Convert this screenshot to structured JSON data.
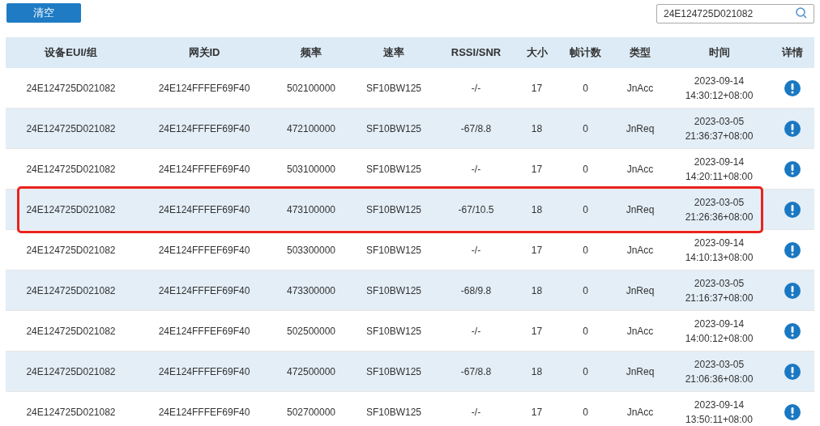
{
  "toolbar": {
    "clear_button": "清空",
    "search": {
      "value": "24E124725D021082"
    }
  },
  "table": {
    "columns": [
      "设备EUI/组",
      "网关ID",
      "频率",
      "速率",
      "RSSI/SNR",
      "大小",
      "帧计数",
      "类型",
      "时间",
      "详情"
    ],
    "rows": [
      {
        "eui": "24E124725D021082",
        "gateway": "24E124FFFEF69F40",
        "freq": "502100000",
        "rate": "SF10BW125",
        "rssi_snr": "-/-",
        "size": "17",
        "fcnt": "0",
        "type": "JnAcc",
        "date": "2023-09-14",
        "time": "14:30:12+08:00",
        "highlighted": false
      },
      {
        "eui": "24E124725D021082",
        "gateway": "24E124FFFEF69F40",
        "freq": "472100000",
        "rate": "SF10BW125",
        "rssi_snr": "-67/8.8",
        "size": "18",
        "fcnt": "0",
        "type": "JnReq",
        "date": "2023-03-05",
        "time": "21:36:37+08:00",
        "highlighted": false
      },
      {
        "eui": "24E124725D021082",
        "gateway": "24E124FFFEF69F40",
        "freq": "503100000",
        "rate": "SF10BW125",
        "rssi_snr": "-/-",
        "size": "17",
        "fcnt": "0",
        "type": "JnAcc",
        "date": "2023-09-14",
        "time": "14:20:11+08:00",
        "highlighted": false
      },
      {
        "eui": "24E124725D021082",
        "gateway": "24E124FFFEF69F40",
        "freq": "473100000",
        "rate": "SF10BW125",
        "rssi_snr": "-67/10.5",
        "size": "18",
        "fcnt": "0",
        "type": "JnReq",
        "date": "2023-03-05",
        "time": "21:26:36+08:00",
        "highlighted": true
      },
      {
        "eui": "24E124725D021082",
        "gateway": "24E124FFFEF69F40",
        "freq": "503300000",
        "rate": "SF10BW125",
        "rssi_snr": "-/-",
        "size": "17",
        "fcnt": "0",
        "type": "JnAcc",
        "date": "2023-09-14",
        "time": "14:10:13+08:00",
        "highlighted": false
      },
      {
        "eui": "24E124725D021082",
        "gateway": "24E124FFFEF69F40",
        "freq": "473300000",
        "rate": "SF10BW125",
        "rssi_snr": "-68/9.8",
        "size": "18",
        "fcnt": "0",
        "type": "JnReq",
        "date": "2023-03-05",
        "time": "21:16:37+08:00",
        "highlighted": false
      },
      {
        "eui": "24E124725D021082",
        "gateway": "24E124FFFEF69F40",
        "freq": "502500000",
        "rate": "SF10BW125",
        "rssi_snr": "-/-",
        "size": "17",
        "fcnt": "0",
        "type": "JnAcc",
        "date": "2023-09-14",
        "time": "14:00:12+08:00",
        "highlighted": false
      },
      {
        "eui": "24E124725D021082",
        "gateway": "24E124FFFEF69F40",
        "freq": "472500000",
        "rate": "SF10BW125",
        "rssi_snr": "-67/8.8",
        "size": "18",
        "fcnt": "0",
        "type": "JnReq",
        "date": "2023-03-05",
        "time": "21:06:36+08:00",
        "highlighted": false
      },
      {
        "eui": "24E124725D021082",
        "gateway": "24E124FFFEF69F40",
        "freq": "502700000",
        "rate": "SF10BW125",
        "rssi_snr": "-/-",
        "size": "17",
        "fcnt": "0",
        "type": "JnAcc",
        "date": "2023-09-14",
        "time": "13:50:11+08:00",
        "highlighted": false
      }
    ]
  }
}
